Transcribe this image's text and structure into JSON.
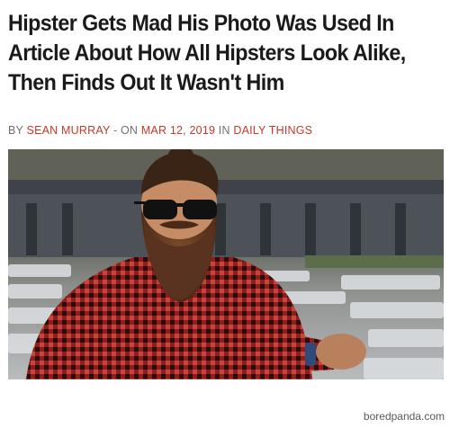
{
  "headline": {
    "line1": "Hipster Gets Mad His Photo Was Used In",
    "line2": "Article About How All Hipsters Look Alike,",
    "line3": "Then Finds Out It Wasn't Him"
  },
  "byline": {
    "prefix": "BY ",
    "author": "SEAN MURRAY",
    "separator": " - ON ",
    "date": "MAR 12, 2019",
    "in": " IN ",
    "category": "DAILY THINGS"
  },
  "colors": {
    "accent": "#c0392b",
    "headline": "#1a1a1a",
    "meta": "#707070"
  },
  "watermark": "boredpanda.com"
}
